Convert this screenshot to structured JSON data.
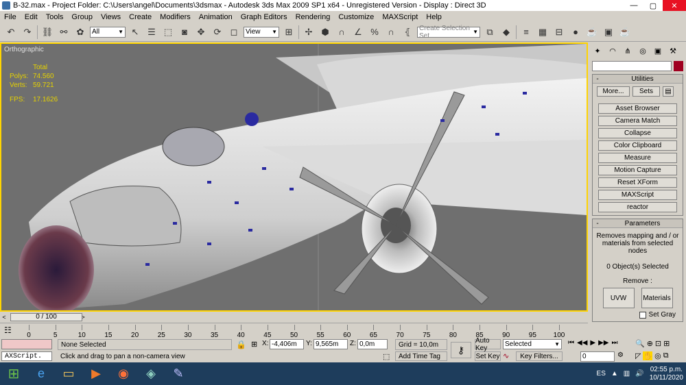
{
  "window": {
    "title": "B-32.max     - Project Folder: C:\\Users\\angel\\Documents\\3dsmax     - Autodesk 3ds Max  2009 SP1  x64   - Unregistered Version     - Display : Direct 3D",
    "min": "—",
    "max": "▢",
    "close": "✕"
  },
  "menu": [
    "File",
    "Edit",
    "Tools",
    "Group",
    "Views",
    "Create",
    "Modifiers",
    "Animation",
    "Graph Editors",
    "Rendering",
    "Customize",
    "MAXScript",
    "Help"
  ],
  "toolbar": {
    "filter_value": "All",
    "view_value": "View",
    "selection_set_placeholder": "Create Selection Set"
  },
  "viewport": {
    "label": "Orthographic",
    "stats_header": "Total",
    "polys_label": "Polys:",
    "polys_value": "74.560",
    "verts_label": "Verts:",
    "verts_value": "59.721",
    "fps_label": "FPS:",
    "fps_value": "17.1626"
  },
  "command_panel": {
    "utilities_title": "Utilities",
    "more_label": "More...",
    "sets_label": "Sets",
    "utility_buttons": [
      "Asset Browser",
      "Camera Match",
      "Collapse",
      "Color Clipboard",
      "Measure",
      "Motion Capture",
      "Reset XForm",
      "MAXScript",
      "reactor"
    ],
    "parameters_title": "Parameters",
    "description": "Removes mapping and / or materials from selected nodes",
    "selected_count": "0 Object(s) Selected",
    "remove_label": "Remove :",
    "uvw_label": "UVW",
    "materials_label": "Materials",
    "set_gray_label": "Set Gray"
  },
  "timeline": {
    "frame_display": "0 / 100",
    "ticks": [
      "0",
      "5",
      "10",
      "15",
      "20",
      "25",
      "30",
      "35",
      "40",
      "45",
      "50",
      "55",
      "60",
      "65",
      "70",
      "75",
      "80",
      "85",
      "90",
      "95",
      "100"
    ]
  },
  "status": {
    "selection": "None Selected",
    "prompt": "Click and drag to pan a non-camera view",
    "maxscript": "AXScript.",
    "x_label": "X:",
    "x_value": "-4,406m",
    "y_label": "Y:",
    "y_value": "9,565m",
    "z_label": "Z:",
    "z_value": "0,0m",
    "grid": "Grid = 10,0m",
    "add_time_tag": "Add Time Tag",
    "auto_key": "Auto Key",
    "set_key": "Set Key",
    "key_mode": "Selected",
    "key_filters": "Key Filters...",
    "frame_value": "0"
  },
  "taskbar": {
    "language": "ES",
    "time": "02:55 p.m.",
    "date": "10/11/2020"
  },
  "colors": {
    "viewport_border": "#ffd400",
    "stats_text": "#e6d200",
    "taskbar_bg": "#1e3d5c"
  }
}
